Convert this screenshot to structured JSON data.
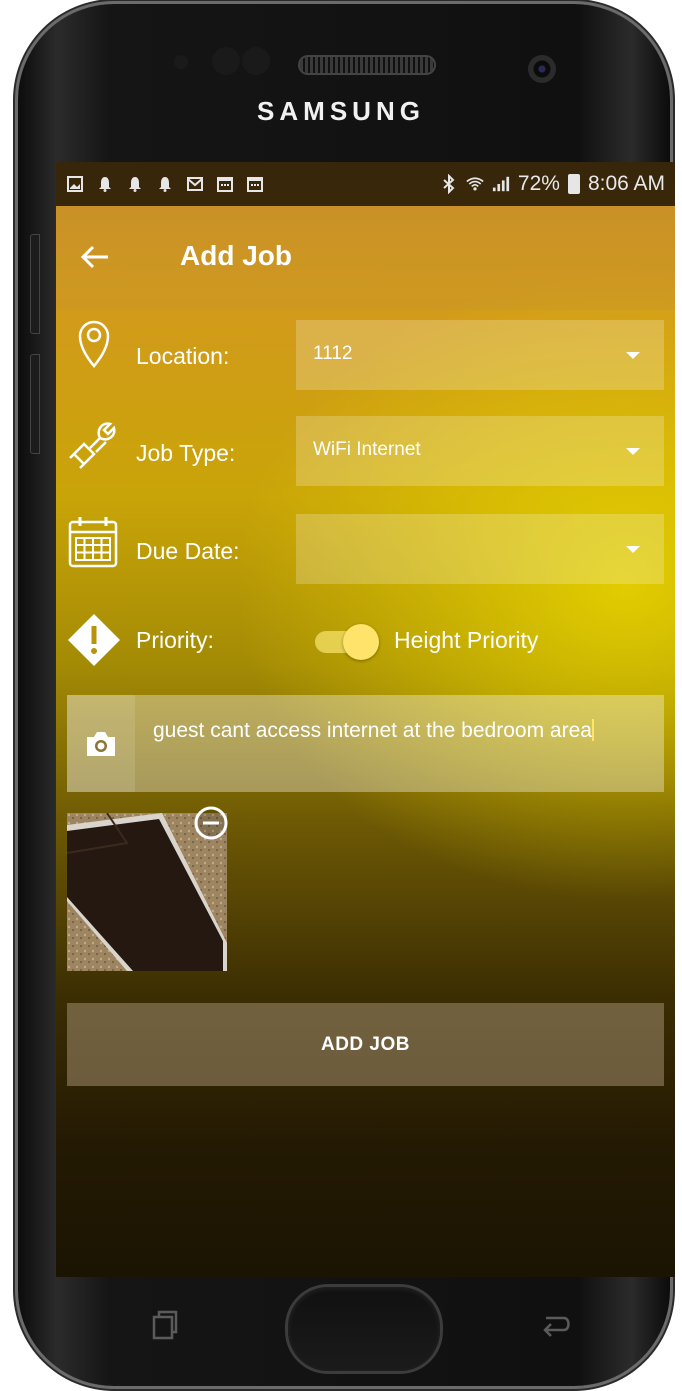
{
  "device": {
    "brand": "SAMSUNG"
  },
  "status_bar": {
    "icons": [
      "gallery-icon",
      "notification-icon",
      "notification-icon",
      "notification-icon",
      "mail-icon",
      "calendar-icon",
      "calendar-icon"
    ],
    "battery": "72%",
    "time": "8:06 AM"
  },
  "app_bar": {
    "title": "Add Job"
  },
  "form": {
    "location": {
      "label": "Location:",
      "value": "1112"
    },
    "job_type": {
      "label": "Job Type:",
      "value": "WiFi Internet"
    },
    "due_date": {
      "label": "Due Date:",
      "value": ""
    },
    "priority": {
      "label": "Priority:",
      "value": "Height Priority",
      "toggle_on": true
    }
  },
  "description": {
    "text": "guest cant access internet at the bedroom area"
  },
  "actions": {
    "add_job_label": "ADD JOB"
  },
  "colors": {
    "accent": "#FFE36A",
    "gradient_top": "#C9882B",
    "gradient_mid": "#C9A408",
    "gradient_bottom": "#1B1403"
  }
}
